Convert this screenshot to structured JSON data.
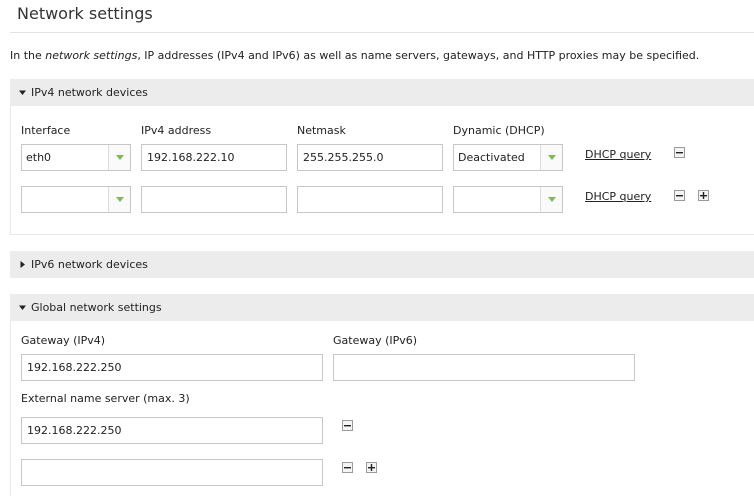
{
  "page": {
    "title": "Network settings",
    "intro_prefix": "In the ",
    "intro_em": "network settings",
    "intro_suffix": ", IP addresses (IPv4 and IPv6) as well as name servers, gateways, and HTTP proxies may be specified."
  },
  "ipv4": {
    "header": "IPv4 network devices",
    "col_interface": "Interface",
    "col_address": "IPv4 address",
    "col_netmask": "Netmask",
    "col_dynamic": "Dynamic (DHCP)",
    "rows": [
      {
        "interface": "eth0",
        "address": "192.168.222.10",
        "netmask": "255.255.255.0",
        "dynamic": "Deactivated",
        "dhcp_link": "DHCP query"
      },
      {
        "interface": "",
        "address": "",
        "netmask": "",
        "dynamic": "",
        "dhcp_link": "DHCP query"
      }
    ]
  },
  "ipv6": {
    "header": "IPv6 network devices"
  },
  "global": {
    "header": "Global network settings",
    "gateway_v4_label": "Gateway (IPv4)",
    "gateway_v4_value": "192.168.222.250",
    "gateway_v6_label": "Gateway (IPv6)",
    "gateway_v6_value": "",
    "nameserver_label": "External name server (max. 3)",
    "nameservers": [
      "192.168.222.250",
      ""
    ]
  },
  "colors": {
    "arrow_green": "#7dbb58",
    "header_bg": "#ececec",
    "border": "#c6c6c6"
  },
  "icons": {
    "expanded": "triangle-down-icon",
    "collapsed": "triangle-right-icon",
    "remove": "minus-icon",
    "add": "plus-icon",
    "dropdown": "chevron-down-icon"
  }
}
